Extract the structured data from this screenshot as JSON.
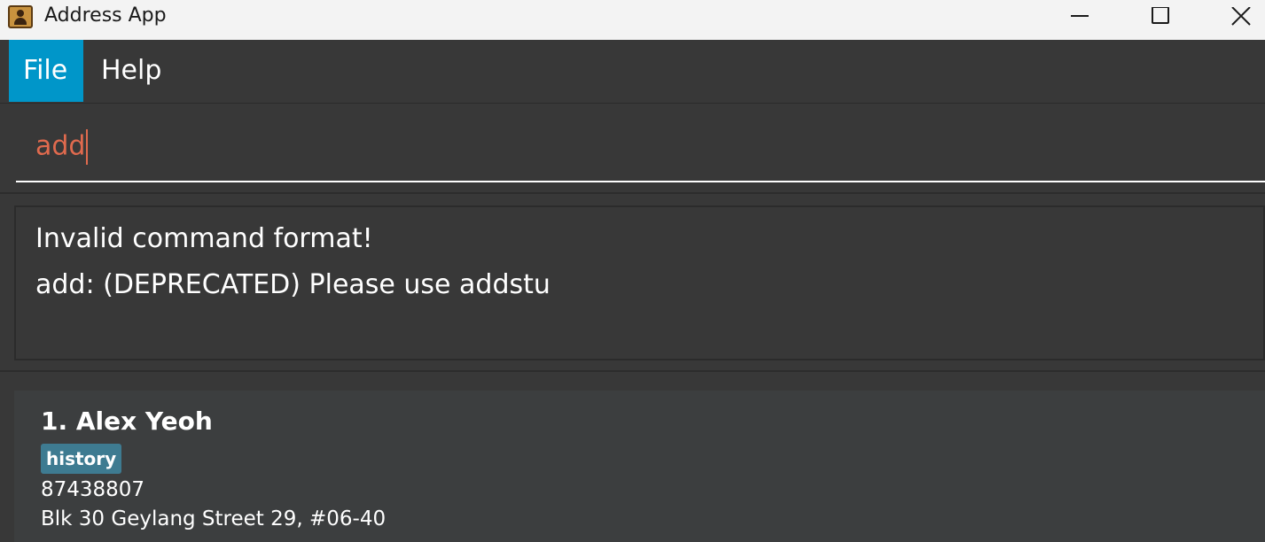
{
  "window": {
    "title": "Address App",
    "icon": "address-book-icon",
    "controls": [
      "minimize-icon",
      "maximize-icon",
      "close-icon"
    ]
  },
  "menu": {
    "items": [
      {
        "label": "File",
        "active": true
      },
      {
        "label": "Help",
        "active": false
      }
    ]
  },
  "command": {
    "value": "add",
    "color": "#e06a4e"
  },
  "result": {
    "lines": [
      "Invalid command format!",
      "add: (DEPRECATED) Please use addstu"
    ]
  },
  "persons": [
    {
      "index_name": "1. Alex Yeoh",
      "tags": [
        "history"
      ],
      "phone": "87438807",
      "address": "Blk 30 Geylang Street 29, #06-40"
    }
  ],
  "colors": {
    "accent": "#0096c9",
    "tag": "#3e7b91",
    "background": "#383838"
  }
}
